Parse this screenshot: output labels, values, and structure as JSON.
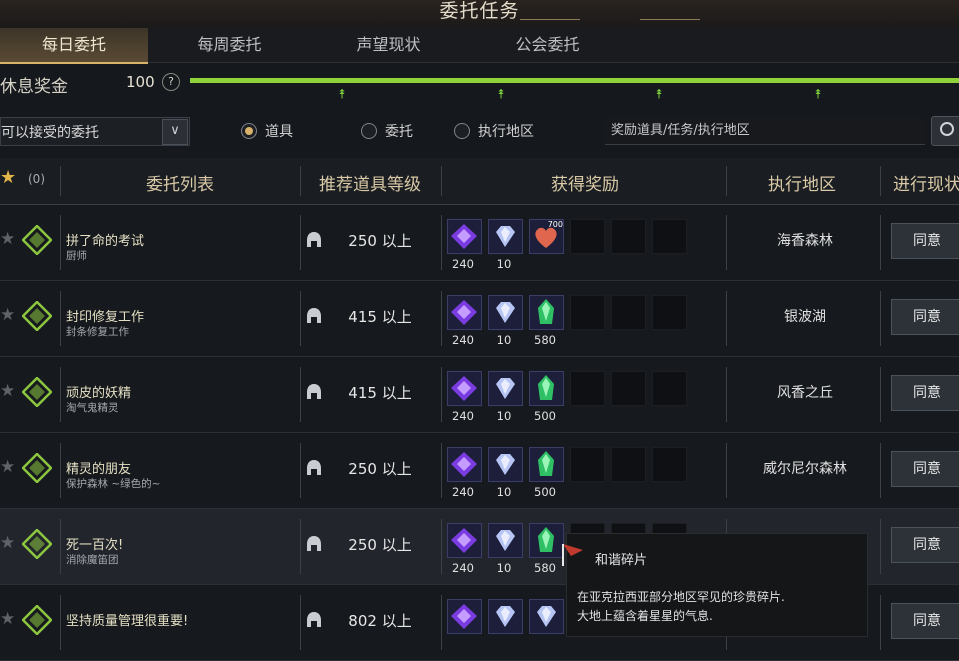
{
  "window": {
    "title": "委托任务"
  },
  "tabs": [
    {
      "label": "每日委托",
      "active": true
    },
    {
      "label": "每周委托",
      "active": false
    },
    {
      "label": "声望现状",
      "active": false
    },
    {
      "label": "公会委托",
      "active": false
    }
  ],
  "rest_bonus": {
    "label": "休息奖金",
    "value": "100",
    "help": "?",
    "progress": 1.0
  },
  "filter": {
    "select_value": "可以接受的委托",
    "dropdown_icon": "chevron-down-icon",
    "radios": [
      {
        "label": "道具",
        "selected": true
      },
      {
        "label": "委托",
        "selected": false
      },
      {
        "label": "执行地区",
        "selected": false
      }
    ],
    "search_placeholder": "奖励道具/任务/执行地区"
  },
  "table": {
    "favorites": {
      "star": "★",
      "count": "(0)"
    },
    "headers": [
      "委托列表",
      "推荐道具等级",
      "获得奖励",
      "执行地区",
      "进行现状"
    ],
    "rows": [
      {
        "name": "拼了命的考试",
        "sub": "厨师",
        "level": "250 以上",
        "region": "海香森林",
        "action": "同意",
        "rewards": [
          {
            "kind": "purple-gem",
            "count": "240"
          },
          {
            "kind": "crystal",
            "count": "10"
          },
          {
            "kind": "heart",
            "count": "",
            "badge": "700"
          }
        ]
      },
      {
        "name": "封印修复工作",
        "sub": "封条修复工作",
        "level": "415 以上",
        "region": "银波湖",
        "action": "同意",
        "rewards": [
          {
            "kind": "purple-gem",
            "count": "240"
          },
          {
            "kind": "crystal",
            "count": "10"
          },
          {
            "kind": "green-shard",
            "count": "580"
          }
        ]
      },
      {
        "name": "顽皮的妖精",
        "sub": "淘气鬼精灵",
        "level": "415 以上",
        "region": "风香之丘",
        "action": "同意",
        "rewards": [
          {
            "kind": "purple-gem",
            "count": "240"
          },
          {
            "kind": "crystal",
            "count": "10"
          },
          {
            "kind": "green-shard",
            "count": "500"
          }
        ]
      },
      {
        "name": "精灵的朋友",
        "sub": "保护森林 ~绿色的~",
        "level": "250 以上",
        "region": "威尔尼尔森林",
        "action": "同意",
        "rewards": [
          {
            "kind": "purple-gem",
            "count": "240"
          },
          {
            "kind": "crystal",
            "count": "10"
          },
          {
            "kind": "green-shard",
            "count": "500"
          }
        ]
      },
      {
        "name": "死一百次!",
        "sub": "消除魔笛团",
        "level": "250 以上",
        "region": "",
        "action": "同意",
        "rewards": [
          {
            "kind": "purple-gem",
            "count": "240"
          },
          {
            "kind": "crystal",
            "count": "10"
          },
          {
            "kind": "green-shard",
            "count": "580"
          }
        ]
      },
      {
        "name": "坚持质量管理很重要!",
        "sub": "",
        "level": "802 以上",
        "region": "",
        "action": "同意",
        "rewards": [
          {
            "kind": "purple-gem",
            "count": ""
          },
          {
            "kind": "crystal",
            "count": ""
          },
          {
            "kind": "crystal",
            "count": ""
          }
        ]
      }
    ]
  },
  "tooltip": {
    "title": "和谐碎片",
    "line1": "在亚克拉西亚部分地区罕见的珍贵碎片.",
    "line2": "大地上蕴含着星星的气息."
  },
  "colors": {
    "accent": "#d8b26a",
    "progress": "#8fd23a",
    "quest_icon": "#8cc63f"
  }
}
